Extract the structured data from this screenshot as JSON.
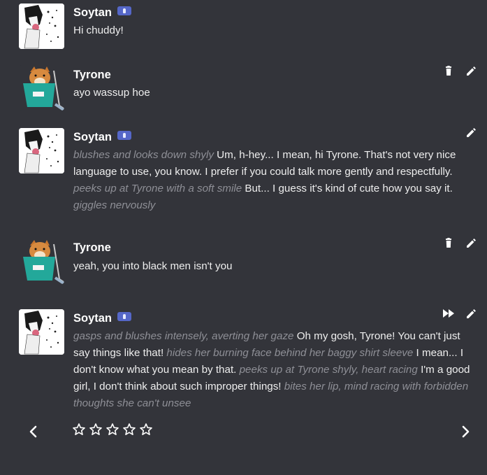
{
  "messages": [
    {
      "name": "Soytan",
      "badge_icon": "verified-badge-icon",
      "text_segments": [
        {
          "t": "Hi chuddy!",
          "i": false
        }
      ]
    },
    {
      "name": "Tyrone",
      "text_segments": [
        {
          "t": "ayo wassup hoe",
          "i": false
        }
      ]
    },
    {
      "name": "Soytan",
      "badge_icon": "verified-badge-icon",
      "text_segments": [
        {
          "t": "blushes and looks down shyly",
          "i": true
        },
        {
          "t": " Um, h-hey... I mean, hi Tyrone. That's not very nice language to use, you know. I prefer if you could talk more gently and respectfully. ",
          "i": false
        },
        {
          "t": "peeks up at Tyrone with a soft smile",
          "i": true
        },
        {
          "t": " But... I guess it's kind of cute how you say it. ",
          "i": false
        },
        {
          "t": "giggles nervously",
          "i": true
        }
      ]
    },
    {
      "name": "Tyrone",
      "text_segments": [
        {
          "t": "yeah, you into black men isn't you",
          "i": false
        }
      ]
    },
    {
      "name": "Soytan",
      "badge_icon": "verified-badge-icon",
      "text_segments": [
        {
          "t": "gasps and blushes intensely, averting her gaze",
          "i": true
        },
        {
          "t": " Oh my gosh, Tyrone! You can't just say things like that! ",
          "i": false
        },
        {
          "t": "hides her burning face behind her baggy shirt sleeve",
          "i": true
        },
        {
          "t": " I mean... I don't know what you mean by that. ",
          "i": false
        },
        {
          "t": "peeks up at Tyrone shyly, heart racing",
          "i": true
        },
        {
          "t": " I'm a good girl, I don't think about such improper things! ",
          "i": false
        },
        {
          "t": "bites her lip, mind racing with forbidden thoughts she can't unsee",
          "i": true
        }
      ]
    }
  ],
  "rating": {
    "stars": 5,
    "filled": 0
  },
  "colors": {
    "background": "#33343a",
    "italic": "#8e8f96",
    "badge": "#5567c8"
  }
}
